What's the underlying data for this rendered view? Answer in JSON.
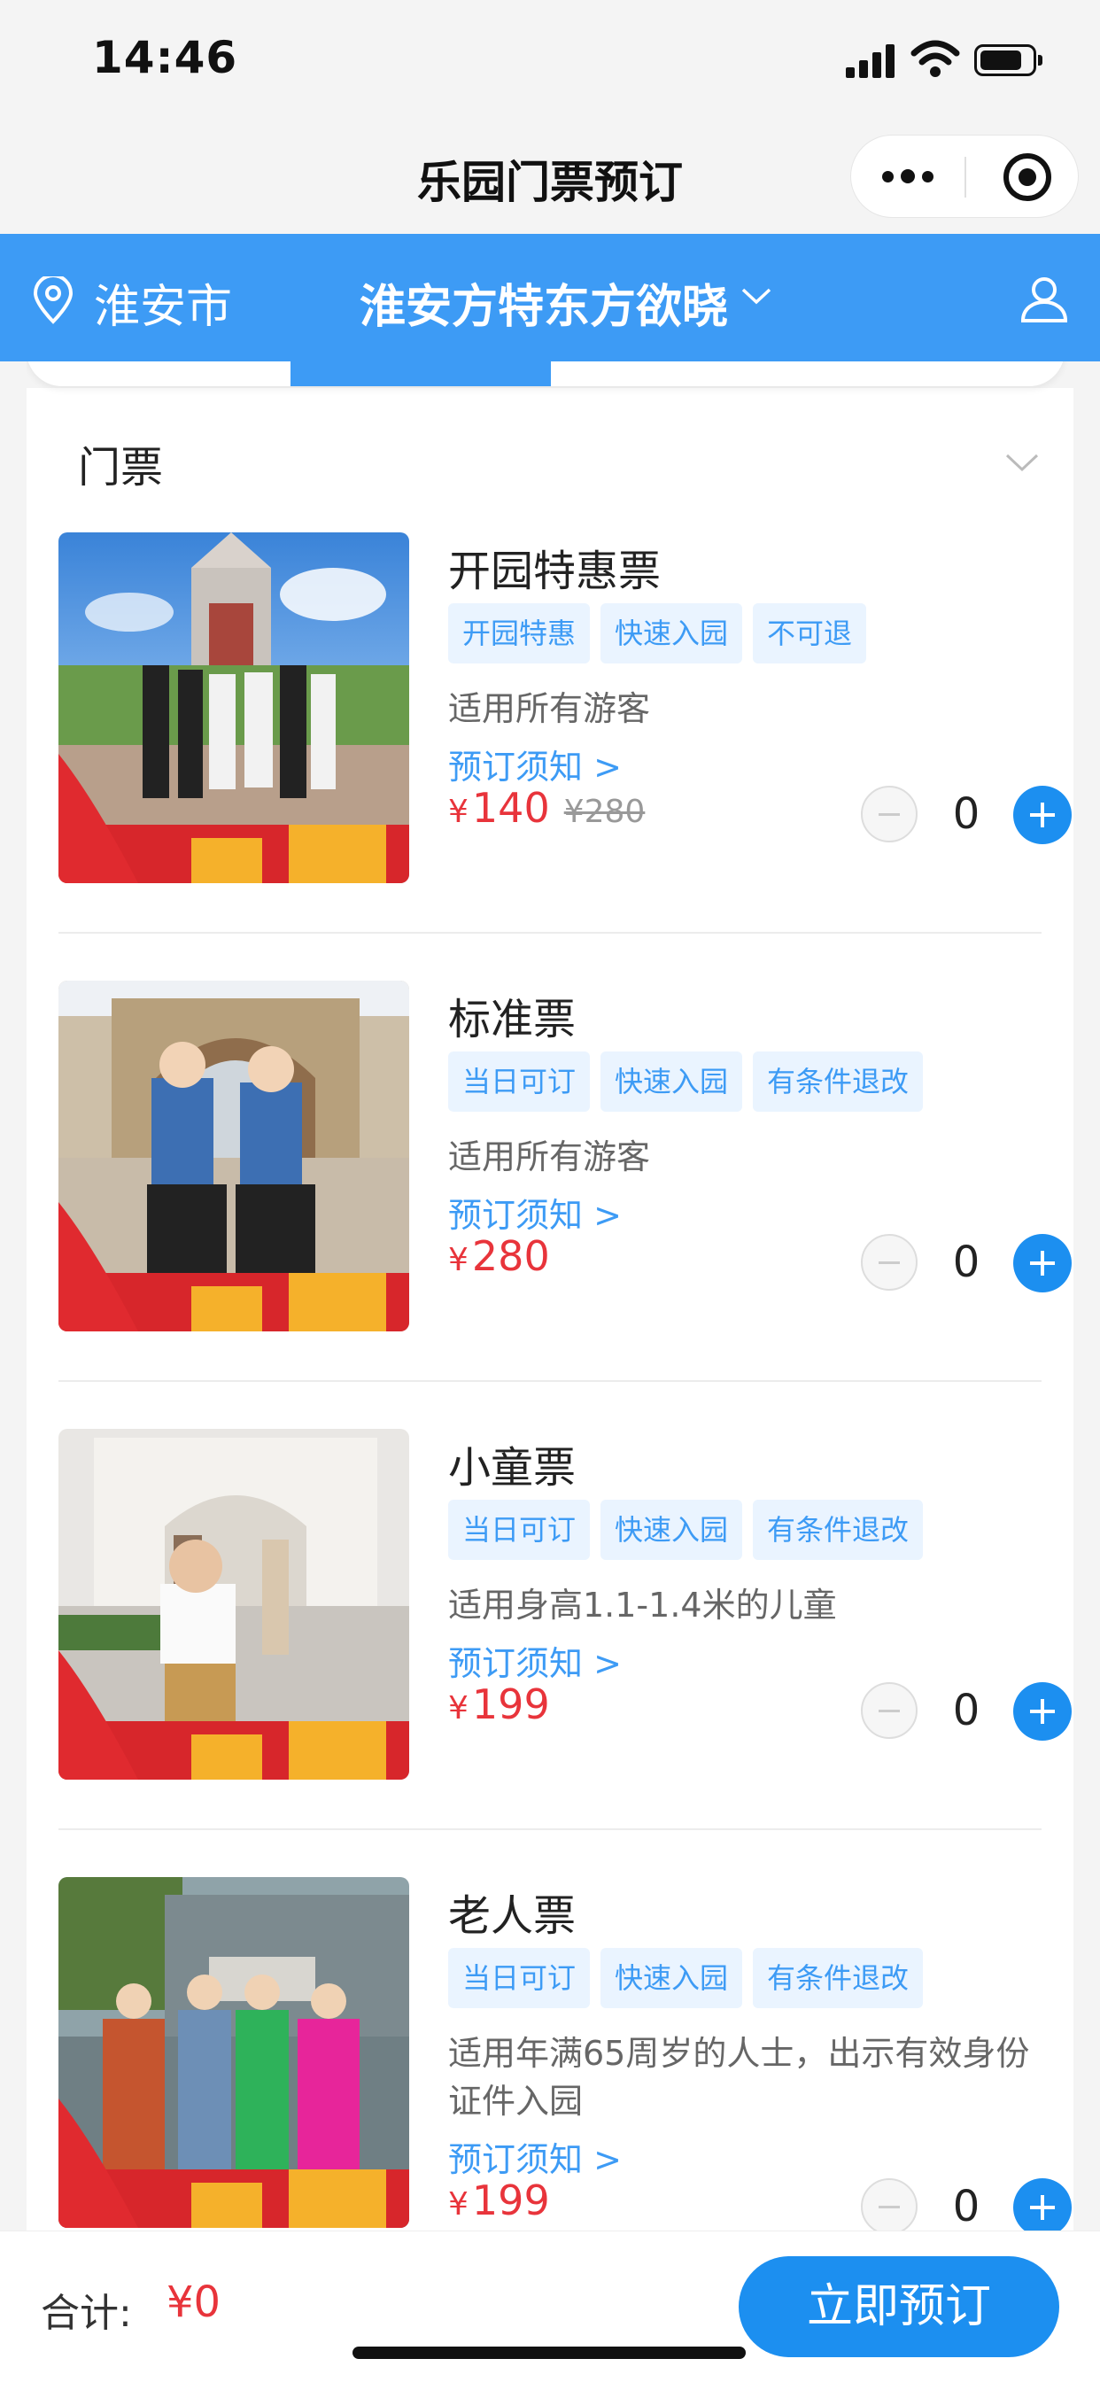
{
  "status_bar": {
    "time": "14:46"
  },
  "nav": {
    "title": "乐园门票预订"
  },
  "header": {
    "city": "淮安市",
    "park": "淮安方特东方欲晓"
  },
  "section": {
    "title": "门票"
  },
  "tickets": [
    {
      "name": "开园特惠票",
      "tags": [
        "开园特惠",
        "快速入园",
        "不可退"
      ],
      "description": "适用所有游客",
      "notice": "预订须知 >",
      "currency": "¥",
      "price": "140",
      "original_price": "¥280",
      "quantity": "0"
    },
    {
      "name": "标准票",
      "tags": [
        "当日可订",
        "快速入园",
        "有条件退改"
      ],
      "description": "适用所有游客",
      "notice": "预订须知 >",
      "currency": "¥",
      "price": "280",
      "quantity": "0"
    },
    {
      "name": "小童票",
      "tags": [
        "当日可订",
        "快速入园",
        "有条件退改"
      ],
      "description": "适用身高1.1-1.4米的儿童",
      "notice": "预订须知 >",
      "currency": "¥",
      "price": "199",
      "quantity": "0"
    },
    {
      "name": "老人票",
      "tags": [
        "当日可订",
        "快速入园",
        "有条件退改"
      ],
      "description": "适用年满65周岁的人士，出示有效身份证件入园",
      "notice": "预订须知 >",
      "currency": "¥",
      "price": "199",
      "quantity": "0"
    }
  ],
  "footer": {
    "total_label": "合计:",
    "total_value": "¥0",
    "book_label": "立即预订"
  },
  "colors": {
    "accent": "#3d9bf5",
    "button": "#1c8ff0",
    "price": "#e8343b"
  }
}
